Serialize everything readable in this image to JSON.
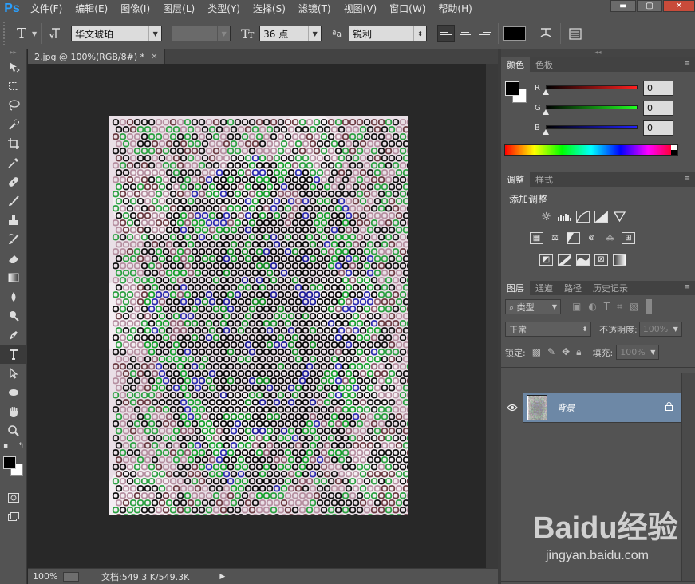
{
  "app": {
    "logo": "Ps"
  },
  "menu": [
    "文件(F)",
    "编辑(E)",
    "图像(I)",
    "图层(L)",
    "类型(Y)",
    "选择(S)",
    "滤镜(T)",
    "视图(V)",
    "窗口(W)",
    "帮助(H)"
  ],
  "window_controls": {
    "minimize": "▬",
    "maximize": "▢",
    "close": "✕"
  },
  "options": {
    "tool_glyph": "T",
    "font_family": "华文琥珀",
    "font_style": "-",
    "font_size": "36 点",
    "aa_label": "ªa",
    "aa_mode": "锐利",
    "text_color": "#000000"
  },
  "document": {
    "tab_title": "2.jpg @ 100%(RGB/8#) *",
    "zoom": "100%",
    "doc_info": "文档:549.3 K/549.3K"
  },
  "color_panel": {
    "tabs": [
      "颜色",
      "色板"
    ],
    "channels": [
      {
        "label": "R",
        "value": "0",
        "color": "#ff2020"
      },
      {
        "label": "G",
        "value": "0",
        "color": "#20ff20"
      },
      {
        "label": "B",
        "value": "0",
        "color": "#2020ff"
      }
    ]
  },
  "adjustments_panel": {
    "tabs": [
      "调整",
      "样式"
    ],
    "title": "添加调整"
  },
  "layers_panel": {
    "tabs": [
      "图层",
      "通道",
      "路径",
      "历史记录"
    ],
    "filter": "类型",
    "blend_mode": "正常",
    "opacity_label": "不透明度:",
    "opacity_value": "100%",
    "lock_label": "锁定:",
    "fill_label": "填充:",
    "fill_value": "100%",
    "layers": [
      {
        "name": "背景",
        "locked": true,
        "visible": true
      }
    ]
  },
  "watermark": {
    "logo": "Baidu经验",
    "url": "jingyan.baidu.com"
  }
}
